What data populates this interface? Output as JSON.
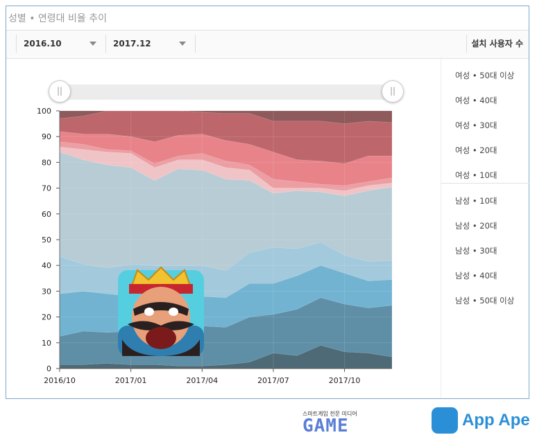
{
  "header": {
    "title": "성별 • 연령대 비율 추이"
  },
  "toolbar": {
    "start": "2016.10",
    "end": "2017.12",
    "metric": "설치 사용자 수"
  },
  "slider": {
    "left_handle": "||",
    "right_handle": "||"
  },
  "legend": [
    "여성 • 50대 이상",
    "여성 • 40대",
    "여성 • 30대",
    "여성 • 20대",
    "여성 • 10대",
    "남성 • 10대",
    "남성 • 20대",
    "남성 • 30대",
    "남성 • 40대",
    "남성 • 50대 이상"
  ],
  "logos": {
    "game_small": "스마트게임 전문 미디어",
    "game_big": "GAME",
    "appape": "App Ape"
  },
  "chart_data": {
    "type": "area",
    "stacked": true,
    "ylim": [
      0,
      100
    ],
    "yticks": [
      0,
      10,
      20,
      30,
      40,
      50,
      60,
      70,
      80,
      90,
      100
    ],
    "x": [
      "2016/10",
      "2016/11",
      "2016/12",
      "2017/01",
      "2017/02",
      "2017/03",
      "2017/04",
      "2017/05",
      "2017/06",
      "2017/07",
      "2017/08",
      "2017/09",
      "2017/10",
      "2017/11",
      "2017/12"
    ],
    "xticks": [
      "2016/10",
      "2017/01",
      "2017/04",
      "2017/07",
      "2017/10"
    ],
    "cumulative_top": [
      {
        "name": "남성 • 50대 이상",
        "color": "#4f6a77",
        "values": [
          1.5,
          1.5,
          2,
          1.5,
          1.5,
          1,
          1,
          1.5,
          2.5,
          6,
          5,
          9,
          6.5,
          6,
          4.5
        ]
      },
      {
        "name": "남성 • 40대",
        "color": "#5e8fa6",
        "values": [
          12.5,
          14.5,
          14,
          14.5,
          14,
          16,
          16.5,
          16,
          20,
          21,
          23,
          27.5,
          25,
          23.5,
          24.5
        ]
      },
      {
        "name": "남성 • 30대",
        "color": "#72b3d1",
        "values": [
          29,
          30,
          29,
          28,
          28.5,
          28.5,
          28,
          27.5,
          33,
          33,
          36,
          40,
          37,
          34,
          34.5
        ]
      },
      {
        "name": "남성 • 20대",
        "color": "#a3c9dc",
        "values": [
          43.5,
          40.5,
          39,
          40.5,
          40,
          40,
          40,
          38,
          45,
          47,
          46.5,
          49,
          44,
          41.5,
          42
        ]
      },
      {
        "name": "남성 • 10대",
        "color": "#b8ccd6",
        "values": [
          84,
          81,
          79,
          78,
          73,
          77.5,
          77,
          73.5,
          73,
          68,
          69,
          68.5,
          67,
          69,
          70.5
        ]
      },
      {
        "name": "여성 • 10대",
        "color": "#f0c4c6",
        "values": [
          86,
          85,
          84,
          83.5,
          78,
          81,
          81,
          78,
          77,
          70,
          70,
          70,
          69,
          71,
          72
        ]
      },
      {
        "name": "여성 • 20대",
        "color": "#ec9ea2",
        "values": [
          88,
          87,
          85,
          84.5,
          79.5,
          82.5,
          83.5,
          80.5,
          79,
          73.5,
          72.5,
          71.5,
          71,
          72.5,
          74
        ]
      },
      {
        "name": "여성 • 30대",
        "color": "#e8838a",
        "values": [
          92,
          91,
          91,
          90,
          88,
          90.5,
          91,
          88.5,
          87,
          84,
          81,
          80.5,
          79.5,
          82.5,
          82.5
        ]
      },
      {
        "name": "여성 • 40대",
        "color": "#bd676c",
        "values": [
          97,
          98,
          100,
          100,
          100,
          100,
          99.5,
          99,
          99,
          96,
          96,
          96,
          95,
          96,
          95.5
        ]
      },
      {
        "name": "여성 • 50대 이상",
        "color": "#8e5a5c",
        "values": [
          100,
          100,
          100,
          100,
          100,
          100,
          100,
          100,
          100,
          100,
          100,
          100,
          100,
          100,
          100
        ]
      }
    ]
  }
}
